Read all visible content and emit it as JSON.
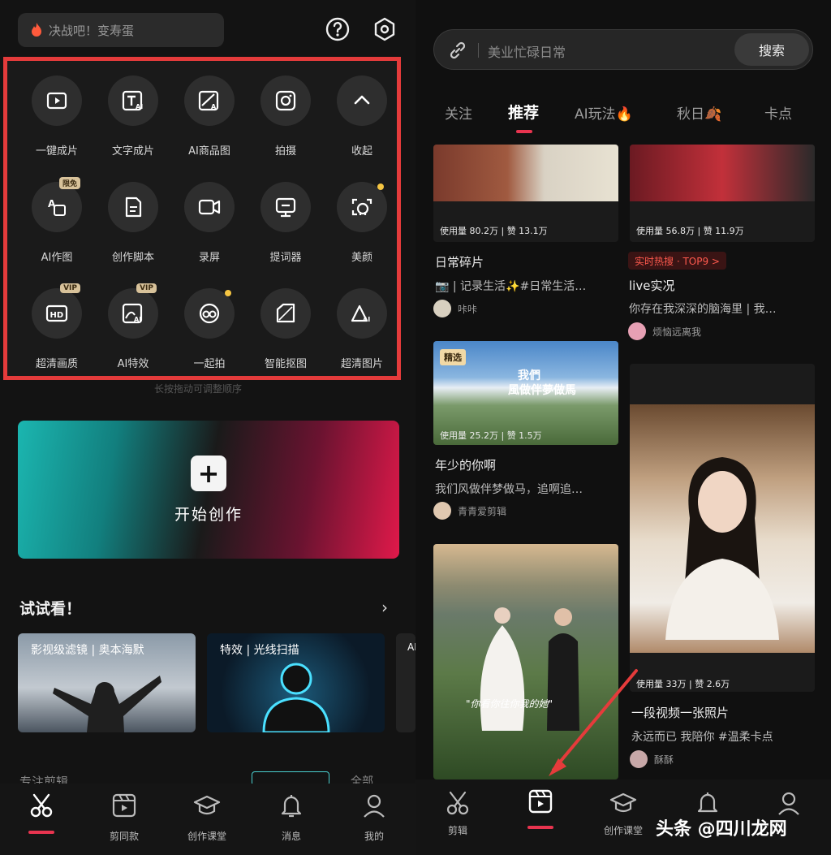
{
  "left": {
    "search_text": "决战吧！变寿蛋",
    "tools": [
      {
        "label": "一键成片",
        "icon": "play-icon"
      },
      {
        "label": "文字成片",
        "icon": "text-ai-icon"
      },
      {
        "label": "AI商品图",
        "icon": "ai-image-icon"
      },
      {
        "label": "拍摄",
        "icon": "camera-icon"
      },
      {
        "label": "收起",
        "icon": "chevron-up-icon"
      },
      {
        "label": "AI作图",
        "icon": "ai-draw-icon",
        "badge": "限免"
      },
      {
        "label": "创作脚本",
        "icon": "script-icon"
      },
      {
        "label": "录屏",
        "icon": "record-icon"
      },
      {
        "label": "提词器",
        "icon": "teleprompter-icon"
      },
      {
        "label": "美颜",
        "icon": "beauty-icon"
      },
      {
        "label": "超清画质",
        "icon": "hd-icon",
        "badge": "VIP"
      },
      {
        "label": "AI特效",
        "icon": "ai-effect-icon",
        "badge": "VIP"
      },
      {
        "label": "一起拍",
        "icon": "together-icon"
      },
      {
        "label": "智能抠图",
        "icon": "cutout-icon"
      },
      {
        "label": "超清图片",
        "icon": "hd-image-icon"
      }
    ],
    "hint": "长按拖动可调整顺序",
    "start_label": "开始创作",
    "try_title": "试试看！",
    "try_cards": [
      {
        "label": "影视级滤镜 | 奥本海默"
      },
      {
        "label": "特效 | 光线扫描"
      },
      {
        "label": "AI"
      }
    ],
    "under_row": "专注剪辑",
    "under_right": "全部",
    "nav": [
      {
        "label": "",
        "icon": "scissors-icon"
      },
      {
        "label": "剪同款",
        "icon": "template-icon"
      },
      {
        "label": "创作课堂",
        "icon": "graduation-cap-icon"
      },
      {
        "label": "消息",
        "icon": "bell-icon"
      },
      {
        "label": "我的",
        "icon": "profile-icon"
      }
    ]
  },
  "right": {
    "search_placeholder": "美业忙碌日常",
    "search_button": "搜索",
    "tabs": [
      "关注",
      "推荐",
      "AI玩法🔥",
      "秋日🍂",
      "卡点"
    ],
    "feed": {
      "c1": {
        "stats": "使用量 80.2万 | 赞 13.1万",
        "title": "日常碎片",
        "desc": "📷 | 记录生活✨#日常生活…",
        "author": "咔咔"
      },
      "c2": {
        "stats": "使用量 56.8万 | 赞 11.9万",
        "hot": "实时热搜 · TOP9 >",
        "title": "live实况",
        "desc": "你存在我深深的脑海里 | 我…",
        "author": "烦恼远离我"
      },
      "c3": {
        "badge": "精选",
        "overlay1": "我們",
        "overlay2": "風做伴夢做馬",
        "stats": "使用量 25.2万 | 赞 1.5万",
        "title": "年少的你啊",
        "desc": "我们风做伴梦做马，追啊追…",
        "author": "青青爱剪辑"
      },
      "c4": {
        "stats": "使用量 33万 | 赞 2.6万",
        "title": "一段视频一张照片",
        "desc": "永远而已 我陪你 #温柔卡点",
        "author": "酥酥"
      },
      "c5": {
        "caption": "\"你看你往你我的她\""
      }
    },
    "nav": [
      {
        "label": "剪辑",
        "icon": "scissors-icon"
      },
      {
        "label": "",
        "icon": "template-icon"
      },
      {
        "label": "创作课堂",
        "icon": "graduation-cap-icon"
      },
      {
        "label": "",
        "icon": "bell-icon"
      },
      {
        "label": "",
        "icon": "profile-icon"
      }
    ],
    "watermark": "头条 @四川龙网",
    "watermark_box": "四川龙网"
  },
  "colors": {
    "accent": "#e8344f",
    "highlight_border": "#e43b3b",
    "badge_gold": "#d8c29a",
    "dot_yellow": "#f5c542"
  }
}
